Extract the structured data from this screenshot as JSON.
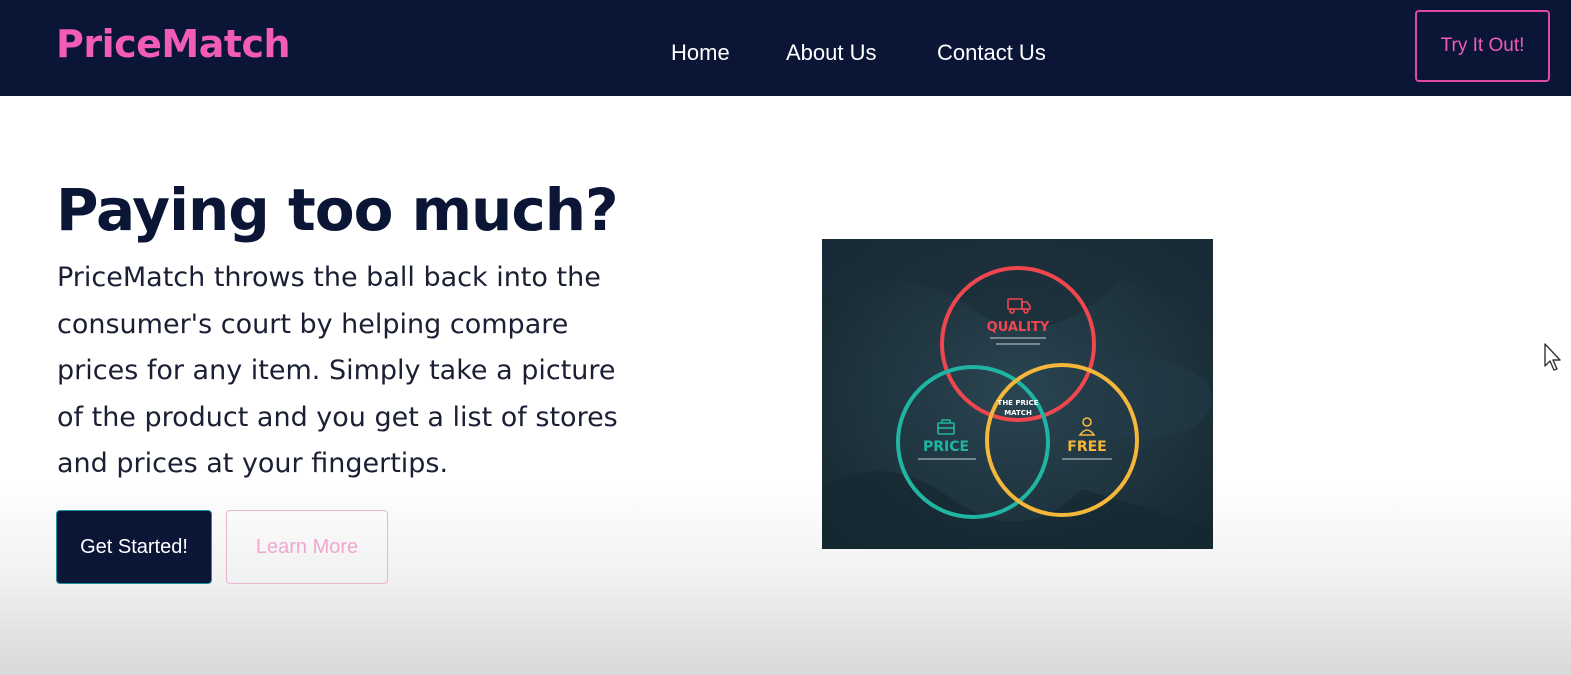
{
  "nav": {
    "logo": "PriceMatch",
    "links": [
      "Home",
      "About Us",
      "Contact Us"
    ],
    "cta": "Try It Out!"
  },
  "hero": {
    "headline": "Paying too much?",
    "description": "PriceMatch throws the ball back into the consumer's court by helping compare prices for any item. Simply take a picture of the product and you get a list of stores and prices at your fingertips.",
    "primary_button": "Get Started!",
    "secondary_button": "Learn More",
    "image": {
      "circles": [
        {
          "label": "QUALITY",
          "color": "#f0474f"
        },
        {
          "label": "PRICE",
          "color": "#1fb5a2"
        },
        {
          "label": "FREE",
          "color": "#f5b73b"
        }
      ],
      "center_label": [
        "THE PRICE",
        "MATCH"
      ],
      "icons": [
        "truck-icon",
        "briefcase-icon",
        "person-icon"
      ]
    }
  },
  "colors": {
    "navbar_bg": "#0b1636",
    "brand_pink": "#f25bb8",
    "headline": "#0b1636",
    "image_bg": "#1d3340"
  }
}
